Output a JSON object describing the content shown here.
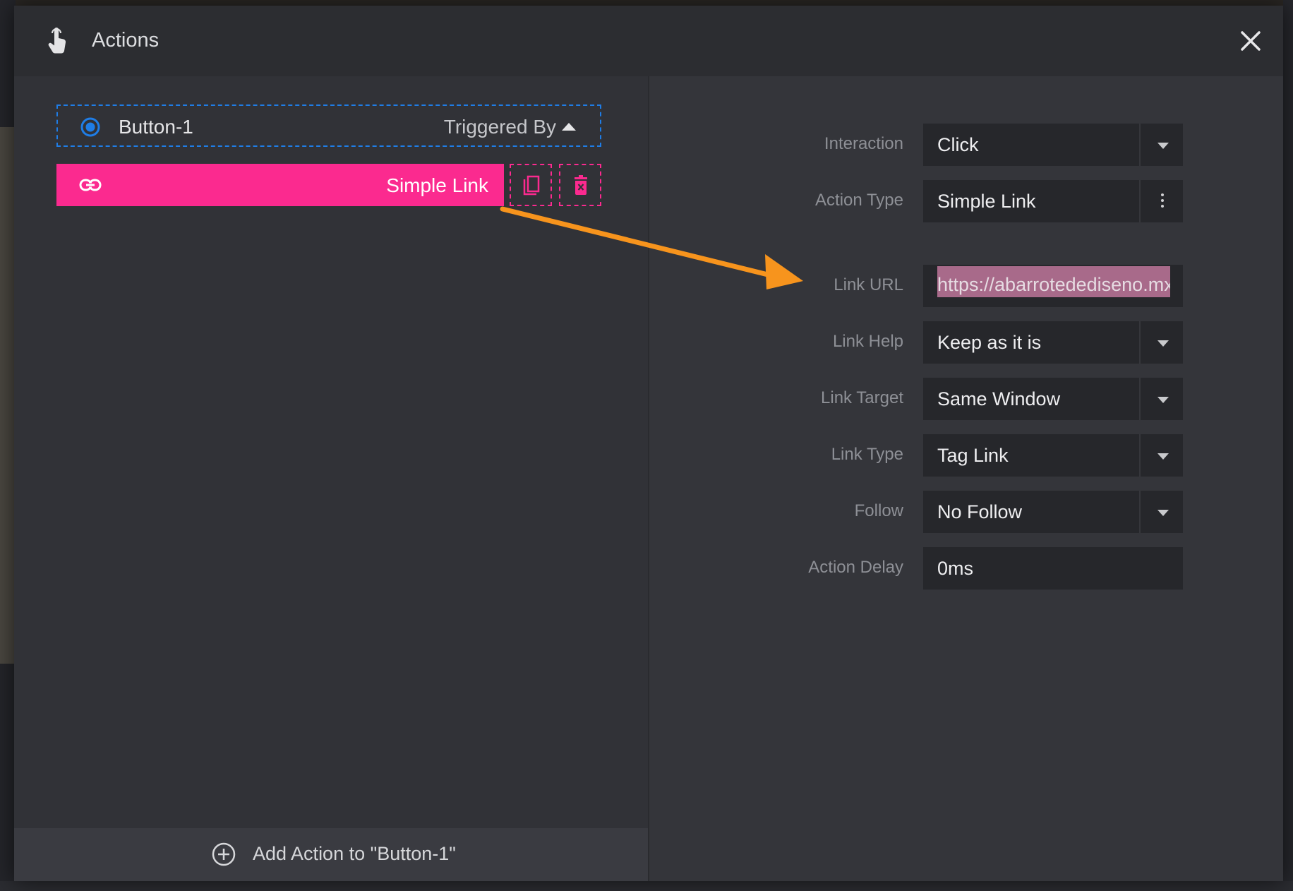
{
  "modal": {
    "title": "Actions",
    "icon": "hand-pointer-icon"
  },
  "trigger": {
    "name": "Button-1",
    "triggered_by_label": "Triggered By"
  },
  "action": {
    "label": "Simple Link",
    "color": "#fb2a8f"
  },
  "add_action": {
    "label": "Add Action to \"Button-1\""
  },
  "fields": {
    "interaction": {
      "label": "Interaction",
      "value": "Click"
    },
    "action_type": {
      "label": "Action Type",
      "value": "Simple Link"
    },
    "link_url": {
      "label": "Link URL",
      "value": "https://abarrotedediseno.mx"
    },
    "link_help": {
      "label": "Link Help",
      "value": "Keep as it is"
    },
    "link_target": {
      "label": "Link Target",
      "value": "Same Window"
    },
    "link_type": {
      "label": "Link Type",
      "value": "Tag Link"
    },
    "follow": {
      "label": "Follow",
      "value": "No Follow"
    },
    "action_delay": {
      "label": "Action Delay",
      "value": "0ms"
    }
  },
  "colors": {
    "accent_blue": "#1f7de6",
    "accent_pink": "#fb2a8f",
    "annotation_arrow": "#f7941d"
  }
}
